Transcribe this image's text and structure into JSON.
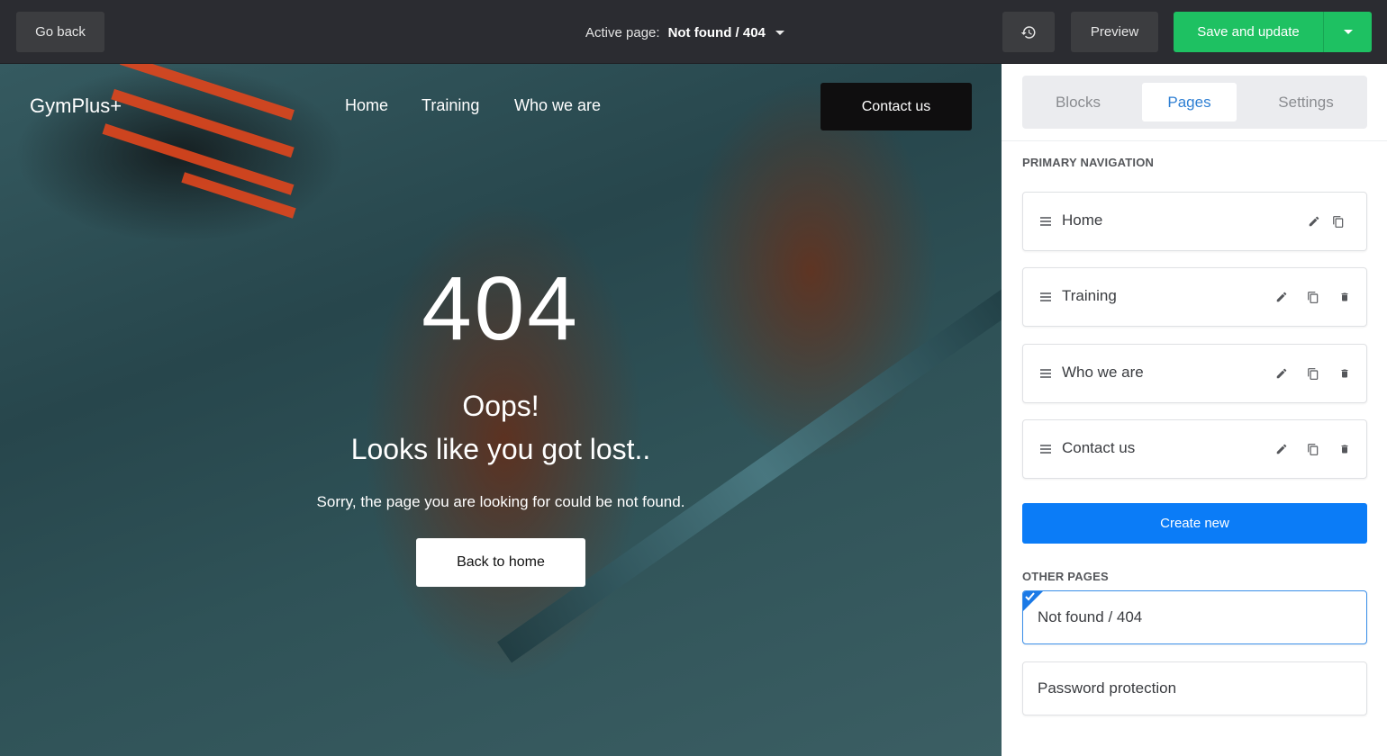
{
  "toolbar": {
    "go_back_label": "Go back",
    "active_page_label": "Active page:",
    "active_page_value": "Not found / 404",
    "history_icon": "history-icon",
    "preview_label": "Preview",
    "save_label": "Save and update",
    "accent_save": "#1ec162"
  },
  "site": {
    "brand": "GymPlus+",
    "nav": [
      "Home",
      "Training",
      "Who we are"
    ],
    "contact_button": "Contact us",
    "hero": {
      "code": "404",
      "title": "Oops!",
      "subtitle": "Looks like you got lost..",
      "message": "Sorry, the page you are looking for could be not found.",
      "button": "Back to home"
    }
  },
  "panel": {
    "tabs": [
      {
        "label": "Blocks",
        "active": false
      },
      {
        "label": "Pages",
        "active": true
      },
      {
        "label": "Settings",
        "active": false
      }
    ],
    "primary_nav_title": "PRIMARY NAVIGATION",
    "primary_nav": [
      {
        "label": "Home",
        "actions": [
          "edit-icon",
          "duplicate-icon"
        ]
      },
      {
        "label": "Training",
        "actions": [
          "edit-icon",
          "duplicate-icon",
          "trash-icon"
        ]
      },
      {
        "label": "Who we are",
        "actions": [
          "edit-icon",
          "duplicate-icon",
          "trash-icon"
        ]
      },
      {
        "label": "Contact us",
        "actions": [
          "edit-icon",
          "duplicate-icon",
          "trash-icon"
        ]
      }
    ],
    "create_new_label": "Create new",
    "other_pages_title": "OTHER PAGES",
    "other_pages": [
      {
        "label": "Not found / 404",
        "selected": true
      },
      {
        "label": "Password protection",
        "selected": false
      }
    ],
    "accent_blue": "#0b7cf7"
  }
}
